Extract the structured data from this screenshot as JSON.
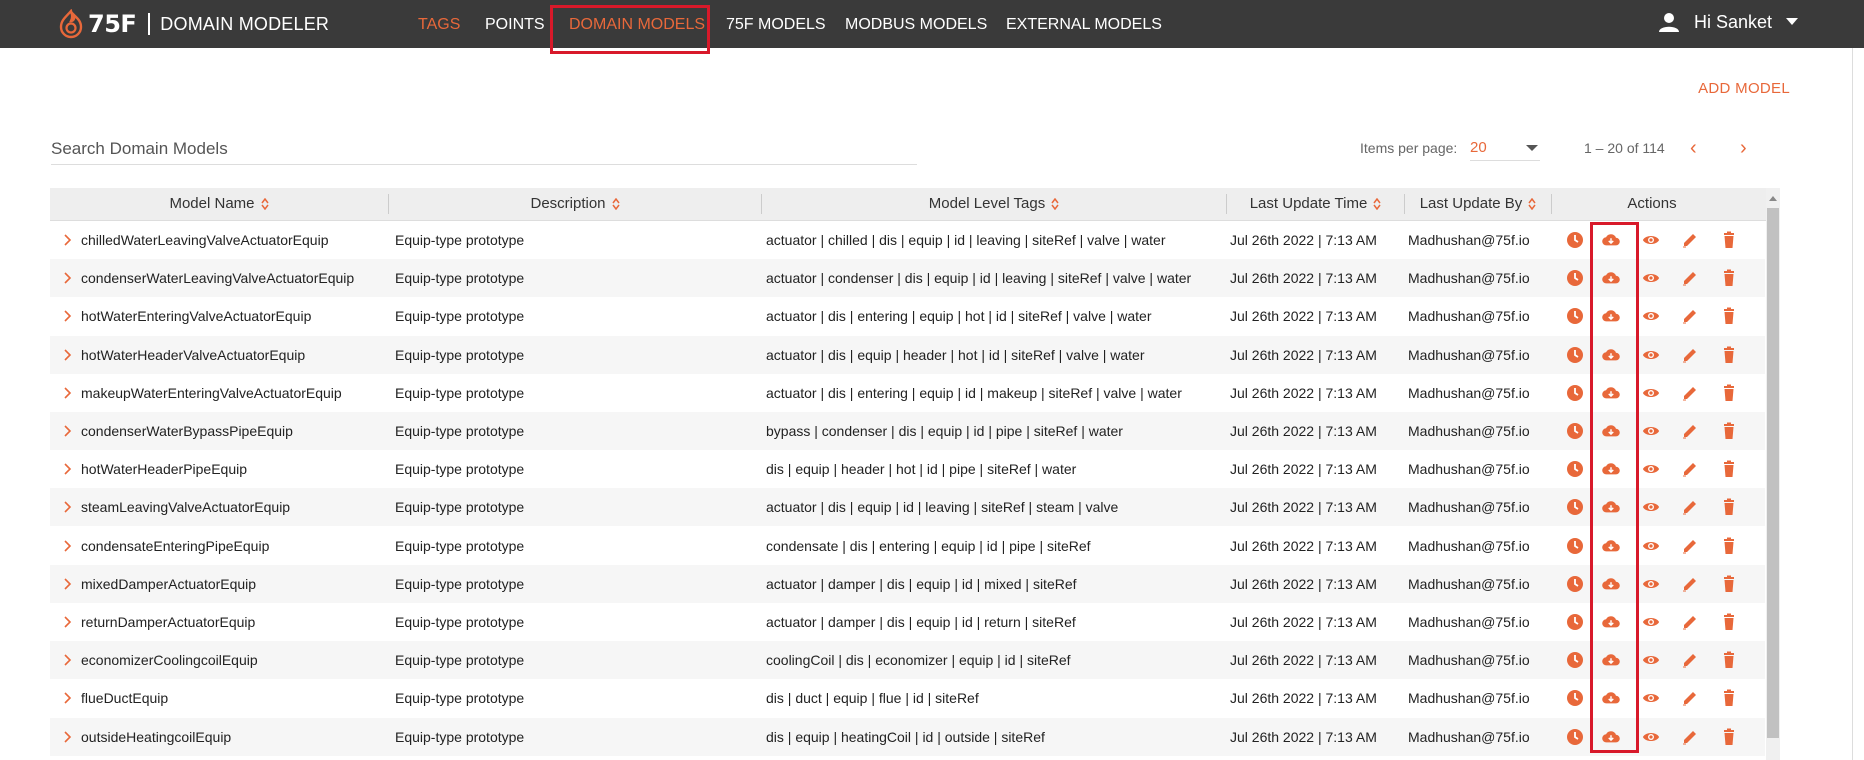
{
  "header": {
    "brand": "75F",
    "app_name": "DOMAIN MODELER",
    "nav": [
      {
        "label": "TAGS",
        "active": true
      },
      {
        "label": "POINTS",
        "active": false
      },
      {
        "label": "DOMAIN MODELS",
        "active": true
      },
      {
        "label": "75F MODELS",
        "active": false
      },
      {
        "label": "MODBUS MODELS",
        "active": false
      },
      {
        "label": "EXTERNAL MODELS",
        "active": false
      }
    ],
    "user_greeting": "Hi Sanket"
  },
  "add_model_label": "ADD MODEL",
  "search": {
    "placeholder": "Search Domain Models"
  },
  "pagination": {
    "items_per_page_label": "Items per page:",
    "items_per_page": "20",
    "range": "1 – 20 of 114",
    "prev": "‹",
    "next": "›"
  },
  "table": {
    "columns": [
      "Model Name",
      "Description",
      "Model Level Tags",
      "Last Update Time",
      "Last Update By",
      "Actions"
    ],
    "rows": [
      {
        "name": "chilledWaterLeavingValveActuatorEquip",
        "description": "Equip-type prototype",
        "tags": "actuator | chilled | dis | equip | id | leaving | siteRef | valve | water",
        "time": "Jul 26th 2022 | 7:13 AM",
        "by": "Madhushan@75f.io"
      },
      {
        "name": "condenserWaterLeavingValveActuatorEquip",
        "description": "Equip-type prototype",
        "tags": "actuator | condenser | dis | equip | id | leaving | siteRef | valve | water",
        "time": "Jul 26th 2022 | 7:13 AM",
        "by": "Madhushan@75f.io"
      },
      {
        "name": "hotWaterEnteringValveActuatorEquip",
        "description": "Equip-type prototype",
        "tags": "actuator | dis | entering | equip | hot | id | siteRef | valve | water",
        "time": "Jul 26th 2022 | 7:13 AM",
        "by": "Madhushan@75f.io"
      },
      {
        "name": "hotWaterHeaderValveActuatorEquip",
        "description": "Equip-type prototype",
        "tags": "actuator | dis | equip | header | hot | id | siteRef | valve | water",
        "time": "Jul 26th 2022 | 7:13 AM",
        "by": "Madhushan@75f.io"
      },
      {
        "name": "makeupWaterEnteringValveActuatorEquip",
        "description": "Equip-type prototype",
        "tags": "actuator | dis | entering | equip | id | makeup | siteRef | valve | water",
        "time": "Jul 26th 2022 | 7:13 AM",
        "by": "Madhushan@75f.io"
      },
      {
        "name": "condenserWaterBypassPipeEquip",
        "description": "Equip-type prototype",
        "tags": "bypass | condenser | dis | equip | id | pipe | siteRef | water",
        "time": "Jul 26th 2022 | 7:13 AM",
        "by": "Madhushan@75f.io"
      },
      {
        "name": "hotWaterHeaderPipeEquip",
        "description": "Equip-type prototype",
        "tags": "dis | equip | header | hot | id | pipe | siteRef | water",
        "time": "Jul 26th 2022 | 7:13 AM",
        "by": "Madhushan@75f.io"
      },
      {
        "name": "steamLeavingValveActuatorEquip",
        "description": "Equip-type prototype",
        "tags": "actuator | dis | equip | id | leaving | siteRef | steam | valve",
        "time": "Jul 26th 2022 | 7:13 AM",
        "by": "Madhushan@75f.io"
      },
      {
        "name": "condensateEnteringPipeEquip",
        "description": "Equip-type prototype",
        "tags": "condensate | dis | entering | equip | id | pipe | siteRef",
        "time": "Jul 26th 2022 | 7:13 AM",
        "by": "Madhushan@75f.io"
      },
      {
        "name": "mixedDamperActuatorEquip",
        "description": "Equip-type prototype",
        "tags": "actuator | damper | dis | equip | id | mixed | siteRef",
        "time": "Jul 26th 2022 | 7:13 AM",
        "by": "Madhushan@75f.io"
      },
      {
        "name": "returnDamperActuatorEquip",
        "description": "Equip-type prototype",
        "tags": "actuator | damper | dis | equip | id | return | siteRef",
        "time": "Jul 26th 2022 | 7:13 AM",
        "by": "Madhushan@75f.io"
      },
      {
        "name": "economizerCoolingcoilEquip",
        "description": "Equip-type prototype",
        "tags": "coolingCoil | dis | economizer | equip | id | siteRef",
        "time": "Jul 26th 2022 | 7:13 AM",
        "by": "Madhushan@75f.io"
      },
      {
        "name": "flueDuctEquip",
        "description": "Equip-type prototype",
        "tags": "dis | duct | equip | flue | id | siteRef",
        "time": "Jul 26th 2022 | 7:13 AM",
        "by": "Madhushan@75f.io"
      },
      {
        "name": "outsideHeatingcoilEquip",
        "description": "Equip-type prototype",
        "tags": "dis | equip | heatingCoil | id | outside | siteRef",
        "time": "Jul 26th 2022 | 7:13 AM",
        "by": "Madhushan@75f.io"
      }
    ],
    "actions": [
      "history-icon",
      "download-icon",
      "view-icon",
      "edit-icon",
      "delete-icon"
    ]
  },
  "colors": {
    "accent": "#e8683a",
    "topbar": "#3a3a3a",
    "highlight": "#d8192a"
  }
}
